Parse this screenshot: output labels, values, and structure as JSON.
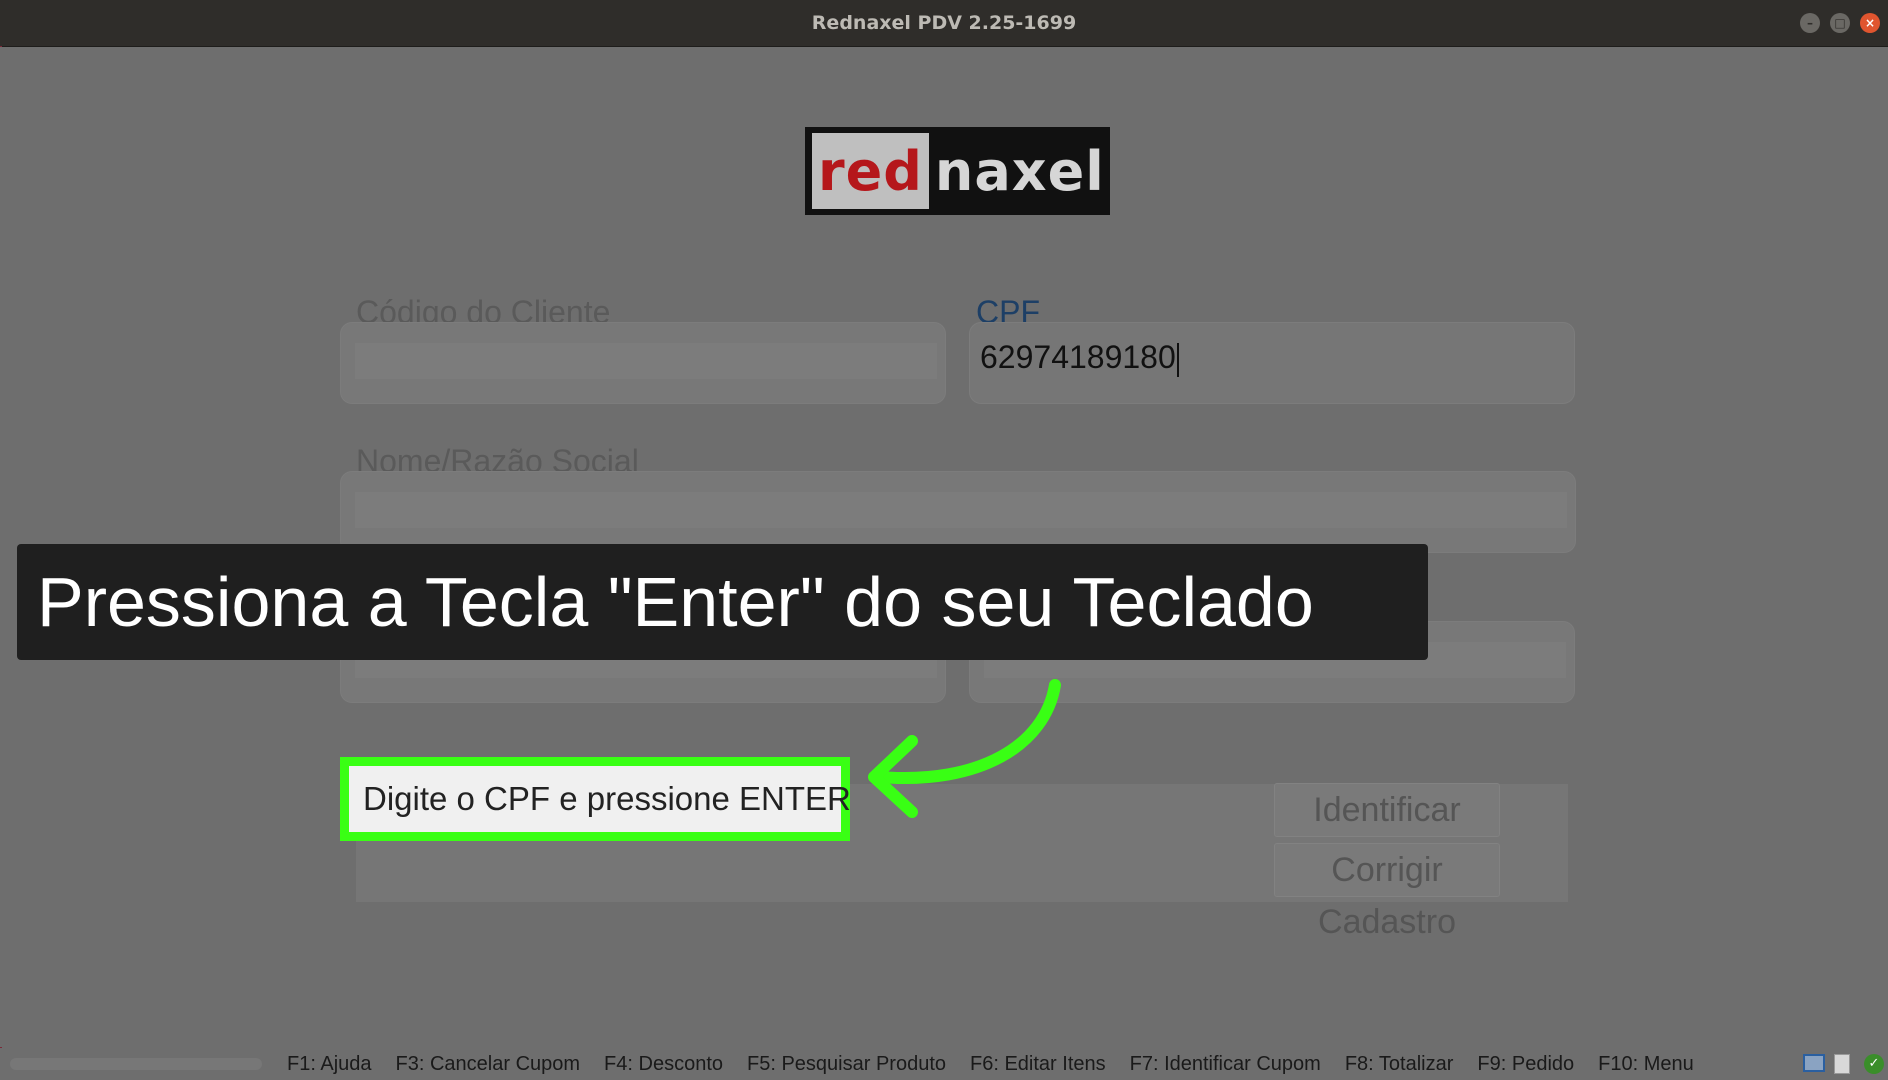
{
  "window": {
    "title": "Rednaxel PDV 2.25-1699"
  },
  "logo": {
    "text_red": "red",
    "text_white": "naxel"
  },
  "form": {
    "codigo_label": "Código do Cliente",
    "codigo_value": "",
    "cpf_label": "CPF",
    "cpf_value": "62974189180",
    "nome_label": "Nome/Razão Social",
    "nome_value": ""
  },
  "tutorial_overlay": {
    "text": "Pressiona a Tecla \"Enter\" do seu Teclado"
  },
  "hint": {
    "text": "Digite o CPF e pressione ENTER"
  },
  "buttons": {
    "identificar": "Identificar Cupom",
    "corrigir": "Corrigir Cadastro"
  },
  "statusbar": {
    "fkeys": [
      "F1: Ajuda",
      "F3: Cancelar Cupom",
      "F4: Desconto",
      "F5: Pesquisar Produto",
      "F6: Editar Itens",
      "F7: Identificar Cupom",
      "F8: Totalizar",
      "F9: Pedido",
      "F10: Menu"
    ]
  },
  "colors": {
    "highlight": "#39ff14",
    "logo_red": "#b5171b",
    "cpf_label": "#1d3f66"
  },
  "icons": {
    "arrow": "curved-arrow-icon",
    "tray_window": "window-icon",
    "tray_doc": "document-icon",
    "tray_status": "check-icon"
  }
}
